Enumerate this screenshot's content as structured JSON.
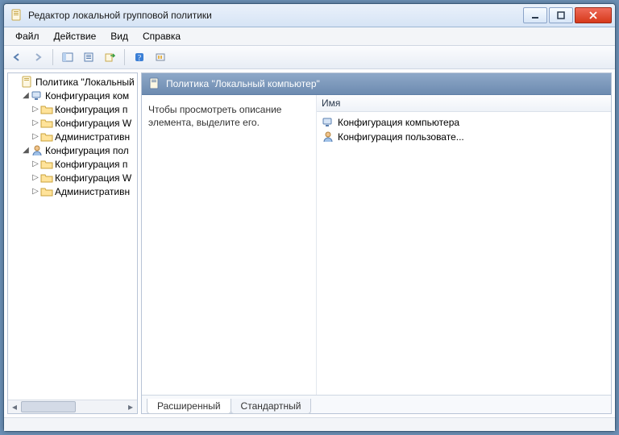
{
  "window": {
    "title": "Редактор локальной групповой политики"
  },
  "menu": {
    "file": "Файл",
    "action": "Действие",
    "view": "Вид",
    "help": "Справка"
  },
  "tree": {
    "root": "Политика \"Локальный",
    "computerConfig": "Конфигурация ком",
    "cc_software": "Конфигурация п",
    "cc_windows": "Конфигурация W",
    "cc_admin": "Административн",
    "userConfig": "Конфигурация пол",
    "uc_software": "Конфигурация п",
    "uc_windows": "Конфигурация W",
    "uc_admin": "Административн"
  },
  "main": {
    "title": "Политика \"Локальный компьютер\"",
    "desc": "Чтобы просмотреть описание элемента, выделите его.",
    "headerName": "Имя",
    "items": {
      "computer": "Конфигурация компьютера",
      "user": "Конфигурация пользовате..."
    }
  },
  "tabs": {
    "extended": "Расширенный",
    "standard": "Стандартный"
  }
}
